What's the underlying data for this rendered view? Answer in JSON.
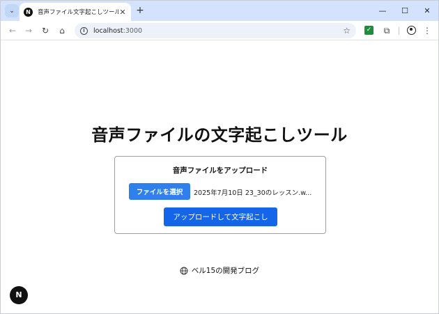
{
  "browser": {
    "tab": {
      "title": "音声ファイル文字起こしツール",
      "favicon_letter": "N",
      "close_glyph": "✕"
    },
    "new_tab_glyph": "+",
    "tab_search_glyph": "⌄",
    "window_controls": {
      "minimize": "—",
      "maximize": "☐",
      "close": "✕"
    },
    "toolbar": {
      "back_glyph": "←",
      "forward_glyph": "→",
      "reload_glyph": "↻",
      "home_glyph": "⌂",
      "url_host": "localhost",
      "url_port": ":3000",
      "star_glyph": "☆",
      "extension_check_glyph": "✓",
      "extensions_glyph": "⧉",
      "menu_glyph": "⋮"
    },
    "icons": [
      "tab-search-icon",
      "favicon-icon",
      "close-icon",
      "plus-icon",
      "back-icon",
      "forward-icon",
      "reload-icon",
      "home-icon",
      "info-icon",
      "star-icon",
      "extension-check-icon",
      "puzzle-icon",
      "profile-icon",
      "menu-icon"
    ]
  },
  "page": {
    "title": "音声ファイルの文字起こしツール",
    "upload": {
      "heading": "音声ファイルをアップロード",
      "choose_button": "ファイルを選択",
      "file_name": "2025年7月10日 23_30のレッスン.w...",
      "submit_button": "アップロードして文字起こし"
    },
    "footer": {
      "link_text": "ベル15の開発ブログ",
      "icon": "globe-icon"
    },
    "dev_badge": "N"
  },
  "colors": {
    "tabstrip": "#d3e3fd",
    "omnibox": "#edf2fa",
    "choose_button": "#2f80ed",
    "submit_button": "#1565e8",
    "extension_check": "#1e8e3e"
  }
}
